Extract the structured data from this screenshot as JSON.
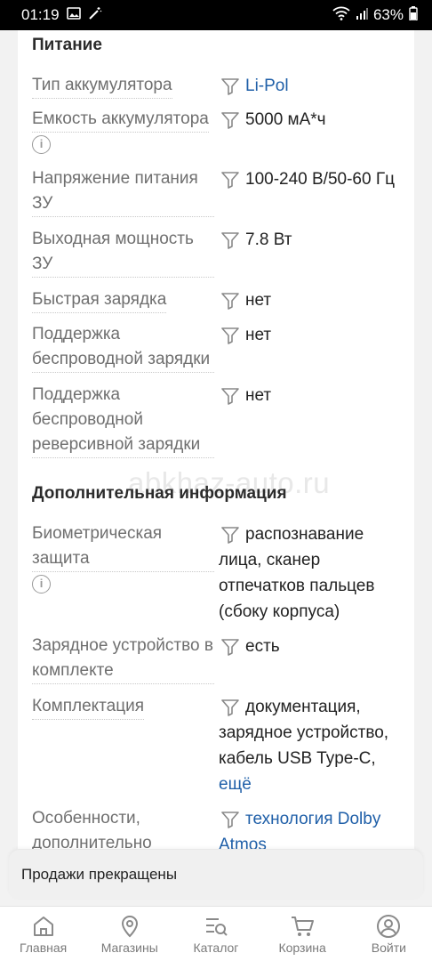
{
  "status_bar": {
    "time": "01:19",
    "battery": "63%"
  },
  "sections": {
    "power": {
      "title": "Питание",
      "rows": [
        {
          "label": "Тип аккумулятора",
          "value": "Li-Pol"
        },
        {
          "label": "Емкость аккумулятора",
          "value": "5000 мА*ч"
        },
        {
          "label": "Напряжение питания ЗУ",
          "value": "100-240 В/50-60 Гц"
        },
        {
          "label": "Выходная мощность ЗУ",
          "value": "7.8 Вт"
        },
        {
          "label": "Быстрая зарядка",
          "value": "нет"
        },
        {
          "label": "Поддержка беспроводной зарядки",
          "value": "нет"
        },
        {
          "label": "Поддержка беспроводной реверсивной зарядки",
          "value": "нет"
        }
      ]
    },
    "extra": {
      "title": "Дополнительная информация",
      "rows": [
        {
          "label": "Биометрическая защита",
          "value": "распознавание лица, сканер отпечатков пальцев (сбоку корпуса)"
        },
        {
          "label": "Зарядное устройство в комплекте",
          "value": "есть"
        },
        {
          "label": "Комплектация",
          "value": "документация, зарядное устройство, кабель USB Type-C,",
          "more": "ещё"
        },
        {
          "label": "Особенности, дополнительно",
          "value": "технология Dolby Atmos"
        }
      ]
    }
  },
  "watermark": "abkhaz-auto.ru",
  "notice": "Продажи прекращены",
  "nav": [
    {
      "label": "Главная",
      "icon": "home-icon"
    },
    {
      "label": "Магазины",
      "icon": "map-pin-icon"
    },
    {
      "label": "Каталог",
      "icon": "catalog-search-icon"
    },
    {
      "label": "Корзина",
      "icon": "cart-icon"
    },
    {
      "label": "Войти",
      "icon": "user-icon"
    }
  ]
}
